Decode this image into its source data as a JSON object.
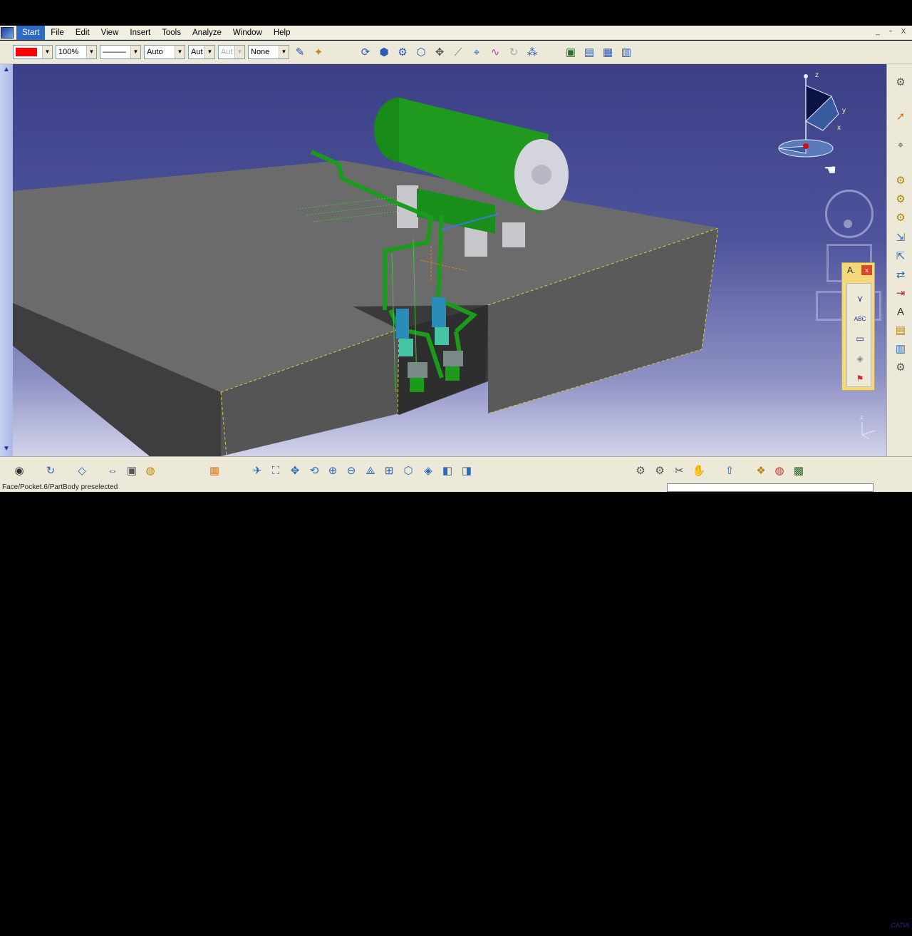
{
  "menubar": {
    "items": [
      {
        "label": "Start",
        "key": "S"
      },
      {
        "label": "File",
        "key": "F"
      },
      {
        "label": "Edit",
        "key": "E"
      },
      {
        "label": "View",
        "key": "V"
      },
      {
        "label": "Insert",
        "key": "I"
      },
      {
        "label": "Tools",
        "key": "T"
      },
      {
        "label": "Analyze",
        "key": "A"
      },
      {
        "label": "Window",
        "key": "W"
      },
      {
        "label": "Help",
        "key": "H"
      }
    ],
    "window_controls": [
      "_",
      "▫",
      "X"
    ]
  },
  "toolbar": {
    "color_value": "#ff0000",
    "transparency": "100%",
    "line_type": "———",
    "thickness": "Auto",
    "point_type": "Aut",
    "layer_disabled": "Aut",
    "render_style": "None"
  },
  "status": {
    "message": "Face/Pocket.6/PartBody preselected"
  },
  "annotation_panel": {
    "title": "A.",
    "close": "x",
    "tools": [
      "⋎",
      "ABC",
      "▭",
      "◈",
      "⚑"
    ]
  },
  "compass": {
    "x": "x",
    "y": "y",
    "z": "z"
  },
  "mini_axis": {
    "z": "z"
  },
  "brand": {
    "logo_text": "CATIA"
  },
  "colors": {
    "floor_top": "#6e6e6e",
    "floor_side": "#4a4a4a",
    "equipment": "#1f9a1f",
    "bg_top": "#3a3f86",
    "bg_bottom": "#d2d3ea"
  }
}
